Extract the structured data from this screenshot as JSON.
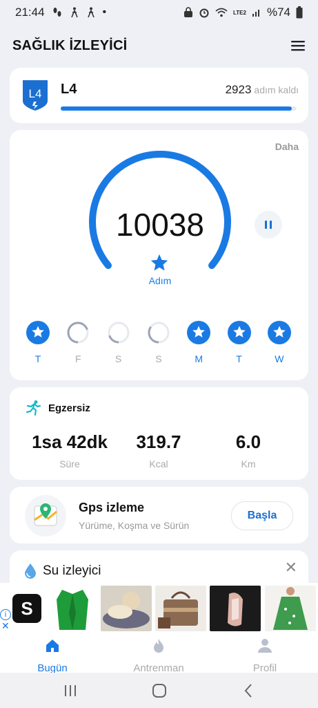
{
  "status_bar": {
    "time": "21:44",
    "battery": "%74",
    "network": "LTE2",
    "dot": "•"
  },
  "app_bar": {
    "title": "SAĞLIK İZLEYİCİ"
  },
  "level_card": {
    "badge": "L4",
    "name": "L4",
    "remaining_steps": "2923",
    "remaining_unit": "adım kaldı",
    "progress_fraction": 0.98
  },
  "steps_card": {
    "more_label": "Daha",
    "steps": "10038",
    "unit": "Adım",
    "ring_fraction": 0.68,
    "days": [
      {
        "label": "T",
        "done": true,
        "fraction": 1
      },
      {
        "label": "F",
        "done": false,
        "fraction": 0.7
      },
      {
        "label": "S",
        "done": false,
        "fraction": 0.2
      },
      {
        "label": "S",
        "done": false,
        "fraction": 0.35
      },
      {
        "label": "M",
        "done": true,
        "fraction": 1
      },
      {
        "label": "T",
        "done": true,
        "fraction": 1
      },
      {
        "label": "W",
        "done": true,
        "fraction": 1
      }
    ]
  },
  "exercise": {
    "title": "Egzersiz",
    "stats": [
      {
        "value": "1sa 42dk",
        "label": "Süre"
      },
      {
        "value": "319.7",
        "label": "Kcal"
      },
      {
        "value": "6.0",
        "label": "Km"
      }
    ]
  },
  "gps": {
    "title": "Gps izleme",
    "subtitle": "Yürüme, Koşma ve Sürün",
    "button": "Başla"
  },
  "water": {
    "title": "Su izleyici",
    "close": "✕"
  },
  "ad": {
    "logo": "S",
    "info": "i",
    "close": "✕"
  },
  "bottom_nav": [
    {
      "label": "Bugün",
      "icon": "home-icon",
      "active": true
    },
    {
      "label": "Antrenman",
      "icon": "flame-icon",
      "active": false
    },
    {
      "label": "Profil",
      "icon": "person-icon",
      "active": false
    }
  ],
  "colors": {
    "accent": "#1a7ae3",
    "background": "#eef0f5"
  }
}
